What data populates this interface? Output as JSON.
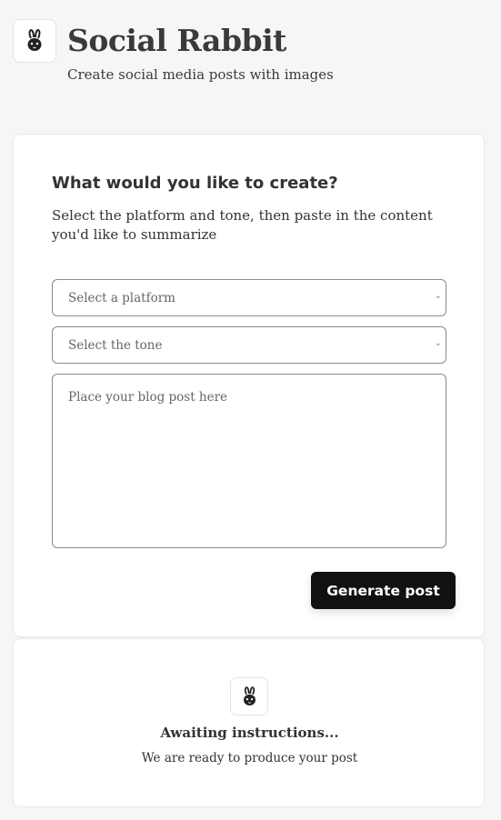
{
  "app": {
    "title": "Social Rabbit",
    "subtitle": "Create social media posts with images",
    "logo_icon": "rabbit-icon"
  },
  "form": {
    "heading": "What would you like to create?",
    "description": "Select the platform and tone, then paste in the content you'd like to summarize",
    "platform_select": {
      "selected": "Select a platform"
    },
    "tone_select": {
      "selected": "Select the tone"
    },
    "content_textarea": {
      "placeholder": "Place your blog post here",
      "value": ""
    },
    "generate_label": "Generate post"
  },
  "status": {
    "icon": "rabbit-icon",
    "title": "Awaiting instructions...",
    "message": "We are ready to produce your post"
  },
  "colors": {
    "background": "#f6f6f6",
    "card": "#ffffff",
    "button": "#111111",
    "button_text": "#ffffff"
  }
}
